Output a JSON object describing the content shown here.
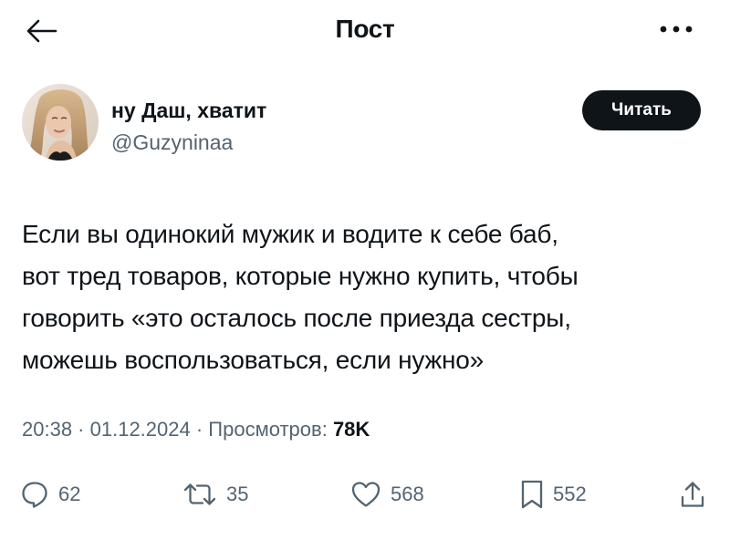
{
  "header": {
    "title": "Пост",
    "back_icon": "arrow-left-icon",
    "more_icon": "ellipsis-icon"
  },
  "author": {
    "display_name": "ну Даш, хватит",
    "handle": "@Guzyninaa",
    "follow_label": "Читать"
  },
  "tweet": {
    "lines": [
      "Если вы одинокий мужик и водите к себе баб,",
      "вот тред товаров, которые нужно купить, чтобы",
      "говорить «это осталось после приезда сестры,",
      "можешь воспользоваться, если нужно»"
    ]
  },
  "meta": {
    "time": "20:38",
    "separator": " · ",
    "date": "01.12.2024",
    "views_label": "Просмотров:",
    "views_count": "78K"
  },
  "actions": {
    "replies": "62",
    "reposts": "35",
    "likes": "568",
    "bookmarks": "552"
  },
  "colors": {
    "text": "#0f1419",
    "secondary": "#536471",
    "button_bg": "#0f1419",
    "button_text": "#ffffff"
  }
}
